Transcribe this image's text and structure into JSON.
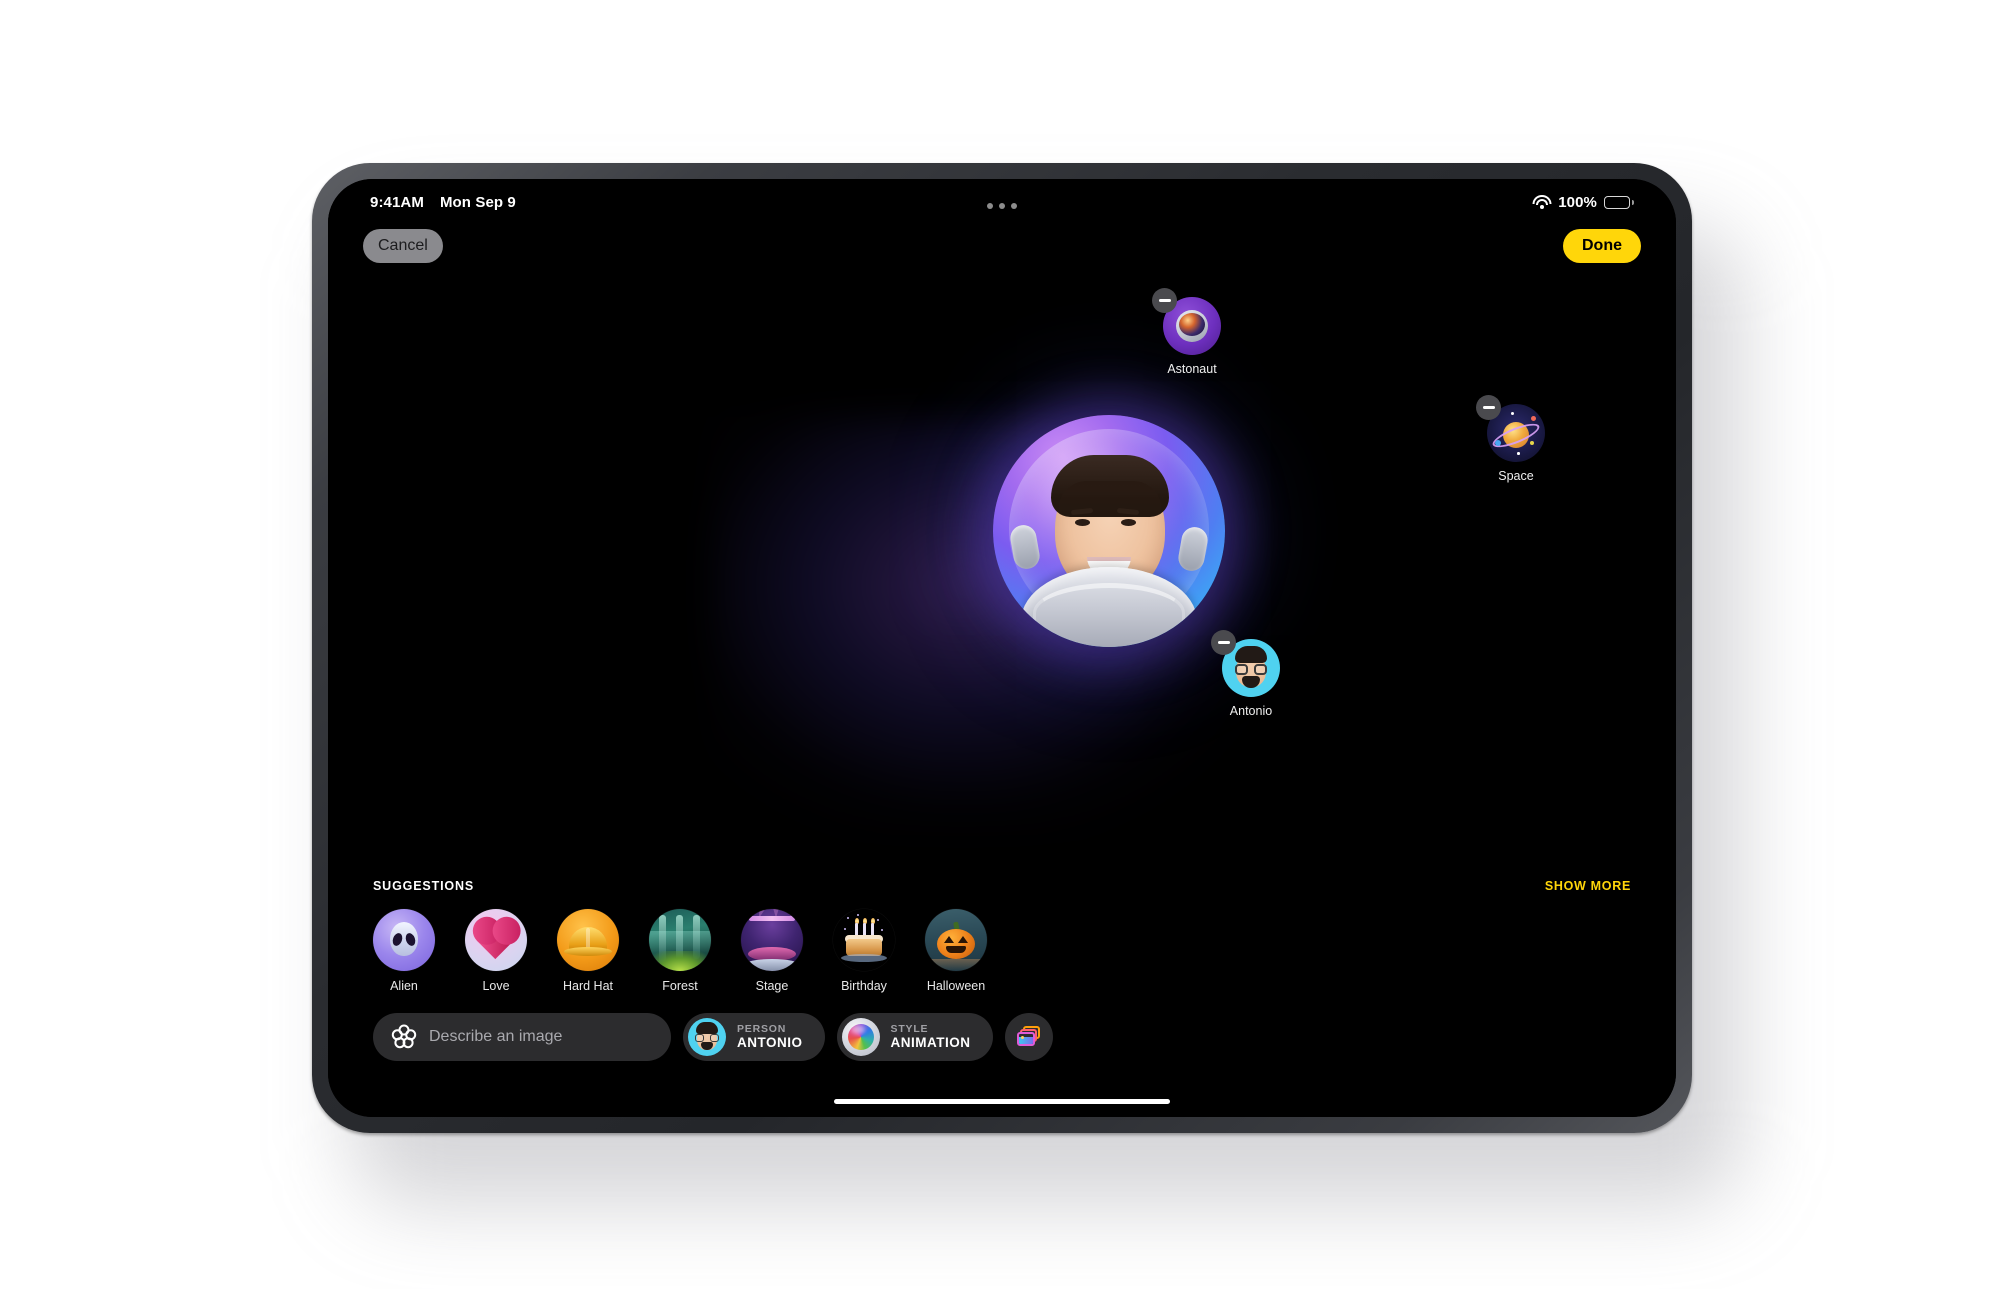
{
  "status_bar": {
    "time": "9:41AM",
    "date": "Mon Sep 9",
    "battery_percent": "100%",
    "wifi_icon": "wifi-icon",
    "battery_icon": "battery-icon"
  },
  "nav": {
    "cancel_label": "Cancel",
    "done_label": "Done"
  },
  "canvas": {
    "main_image_alt": "astronaut-portrait",
    "concepts": [
      {
        "label": "Astonaut",
        "icon": "astronaut-helmet-icon",
        "remove_label": "remove"
      },
      {
        "label": "Space",
        "icon": "saturn-planet-icon",
        "remove_label": "remove"
      },
      {
        "label": "Antonio",
        "icon": "memoji-avatar-icon",
        "remove_label": "remove"
      }
    ]
  },
  "suggestions": {
    "title": "SUGGESTIONS",
    "show_more_label": "SHOW MORE",
    "items": [
      {
        "label": "Alien",
        "icon": "alien-icon"
      },
      {
        "label": "Love",
        "icon": "heart-icon"
      },
      {
        "label": "Hard Hat",
        "icon": "hard-hat-icon"
      },
      {
        "label": "Forest",
        "icon": "forest-icon"
      },
      {
        "label": "Stage",
        "icon": "stage-icon"
      },
      {
        "label": "Birthday",
        "icon": "birthday-cake-icon"
      },
      {
        "label": "Halloween",
        "icon": "pumpkin-icon"
      }
    ]
  },
  "toolbar": {
    "describe_placeholder": "Describe an image",
    "describe_value": "",
    "describe_icon": "image-playground-icon",
    "person_chip": {
      "kicker": "PERSON",
      "value": "ANTONIO",
      "icon": "memoji-avatar-icon"
    },
    "style_chip": {
      "kicker": "STYLE",
      "value": "ANIMATION",
      "icon": "style-orb-icon"
    },
    "photo_library_icon": "photos-library-icon"
  },
  "colors": {
    "accent_yellow": "#ffd60a",
    "surface": "#2c2c2e",
    "screen_bg": "#000000",
    "cancel_bg": "#8a8a8e"
  }
}
